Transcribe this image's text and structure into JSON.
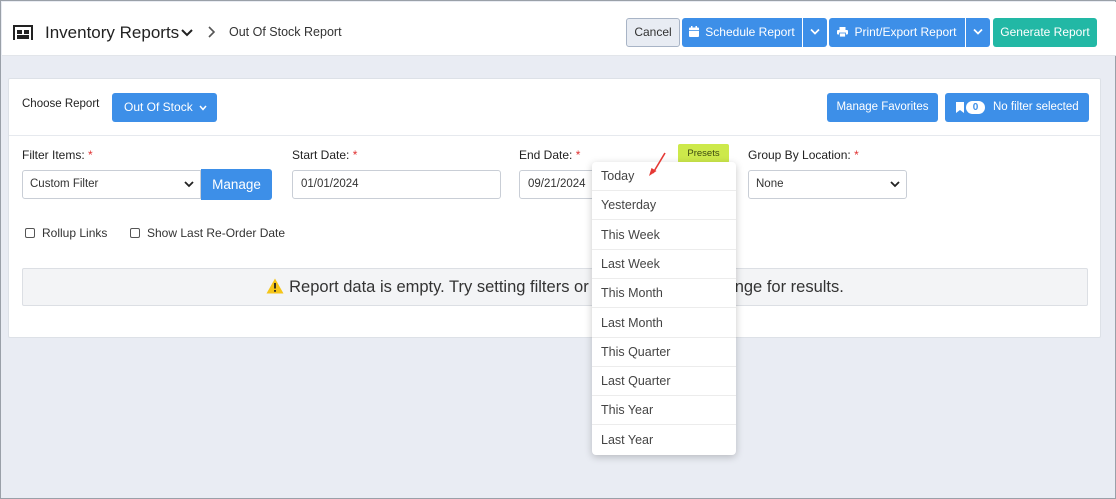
{
  "header": {
    "title": "Inventory Reports",
    "breadcrumb": "Out Of Stock Report",
    "cancel_label": "Cancel",
    "schedule_label": "Schedule Report",
    "print_label": "Print/Export Report",
    "generate_label": "Generate Report"
  },
  "toolbar": {
    "choose_label": "Choose Report",
    "report_value": "Out Of Stock",
    "favorites_label": "Manage Favorites",
    "filter_count": "0",
    "filter_label": "No filter selected"
  },
  "filters": {
    "filter_items_label": "Filter Items:",
    "filter_items_value": "Custom Filter",
    "manage_label": "Manage",
    "start_label": "Start Date:",
    "start_value": "01/01/2024",
    "end_label": "End Date:",
    "end_value": "09/21/2024",
    "presets_label": "Presets",
    "group_label": "Group By Location:",
    "group_value": "None",
    "required_mark": "*"
  },
  "options": {
    "rollup_label": "Rollup Links",
    "reorder_label": "Show Last Re-Order Date"
  },
  "alert": {
    "message_left": "Report data is empty. Try setting filters or",
    "message_right": "nge for results."
  },
  "preset_menu": {
    "items": [
      "Today",
      "Yesterday",
      "This Week",
      "Last Week",
      "This Month",
      "Last Month",
      "This Quarter",
      "Last Quarter",
      "This Year",
      "Last Year"
    ]
  },
  "colors": {
    "primary": "#3d8fe8",
    "success": "#22b8a5",
    "presets_bg": "#cde94b",
    "required": "#e03131",
    "annotation_arrow": "#e53935"
  },
  "icons": {
    "app": "warehouse-icon",
    "title_dropdown": "chevron-down-icon",
    "breadcrumb_separator": "chevron-right-icon",
    "schedule": "calendar-icon",
    "print": "printer-icon",
    "filter": "bookmark-icon",
    "alert": "warning-icon"
  }
}
